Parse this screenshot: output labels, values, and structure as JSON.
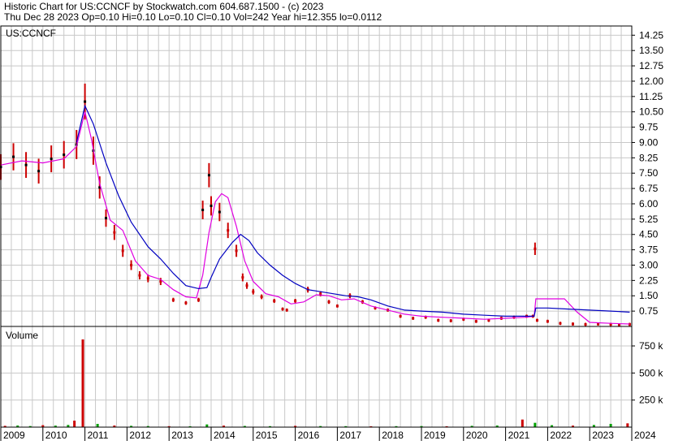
{
  "header": {
    "line1": "Historic Chart for US:CCNCF by Stockwatch.com 604.687.1500 - (c) 2023",
    "line2": "Thu Dec 28 2023  Op=0.10  Hi=0.10  Lo=0.10  Cl=0.10  Vol=242  Year hi=12.355  lo=0.0112"
  },
  "colors": {
    "background": "#ffffff",
    "grid": "#c8c8c8",
    "frame": "#000000",
    "price_bars": "#cc0000",
    "price_bars_dark": "#000000",
    "ma_short": "#e000e0",
    "ma_long": "#0000c0",
    "volume_up": "#00a000",
    "volume_down": "#cc0000"
  },
  "chart_data": [
    {
      "type": "line",
      "title": "US:CCNCF",
      "xlabel": "",
      "ylabel": "",
      "ylim": [
        0,
        14.7
      ],
      "xlim": [
        2009.0,
        2024.0
      ],
      "y_ticks": [
        "0.75",
        "1.50",
        "2.25",
        "3.00",
        "3.75",
        "4.50",
        "5.25",
        "6.00",
        "6.75",
        "7.50",
        "8.25",
        "9.00",
        "9.75",
        "10.50",
        "11.25",
        "12.00",
        "12.75",
        "13.50",
        "14.25"
      ],
      "y_tick_values": [
        0.75,
        1.5,
        2.25,
        3.0,
        3.75,
        4.5,
        5.25,
        6.0,
        6.75,
        7.5,
        8.25,
        9.0,
        9.75,
        10.5,
        11.25,
        12.0,
        12.75,
        13.5,
        14.25
      ],
      "grid": true,
      "series": [
        {
          "role": "price",
          "x": [
            2009.0,
            2009.3,
            2009.6,
            2009.9,
            2010.2,
            2010.5,
            2010.8,
            2011.0,
            2011.2,
            2011.35,
            2011.5,
            2011.7,
            2011.9,
            2012.1,
            2012.3,
            2012.5,
            2012.8,
            2013.1,
            2013.4,
            2013.7,
            2013.8,
            2013.95,
            2014.0,
            2014.2,
            2014.4,
            2014.6,
            2014.75,
            2014.85,
            2015.0,
            2015.2,
            2015.5,
            2015.7,
            2015.8,
            2016.0,
            2016.3,
            2016.6,
            2016.8,
            2017.0,
            2017.3,
            2017.6,
            2017.9,
            2018.2,
            2018.5,
            2018.8,
            2019.1,
            2019.4,
            2019.7,
            2020.0,
            2020.3,
            2020.6,
            2020.9,
            2021.2,
            2021.5,
            2021.65,
            2021.7,
            2021.75,
            2022.0,
            2022.3,
            2022.6,
            2022.9,
            2023.2,
            2023.5,
            2023.7,
            2023.95
          ],
          "values": [
            7.8,
            8.3,
            7.9,
            7.6,
            8.2,
            8.4,
            8.9,
            11.0,
            8.6,
            6.8,
            5.3,
            4.6,
            3.7,
            3.0,
            2.5,
            2.35,
            2.2,
            1.3,
            1.15,
            1.3,
            5.7,
            7.4,
            5.9,
            5.6,
            4.7,
            3.7,
            2.4,
            2.0,
            1.7,
            1.45,
            1.25,
            0.85,
            0.8,
            1.25,
            1.8,
            1.6,
            1.2,
            1.0,
            1.5,
            1.2,
            0.9,
            0.8,
            0.5,
            0.4,
            0.45,
            0.3,
            0.28,
            0.35,
            0.25,
            0.3,
            0.4,
            0.45,
            0.5,
            0.5,
            3.8,
            0.3,
            0.25,
            0.15,
            0.12,
            0.1,
            0.12,
            0.1,
            0.08,
            0.1
          ]
        },
        {
          "role": "moving-average-short",
          "x": [
            2009.0,
            2009.5,
            2010.0,
            2010.5,
            2010.8,
            2011.0,
            2011.15,
            2011.35,
            2011.6,
            2011.9,
            2012.2,
            2012.5,
            2012.8,
            2013.1,
            2013.4,
            2013.65,
            2013.8,
            2013.95,
            2014.1,
            2014.25,
            2014.4,
            2014.6,
            2014.8,
            2015.0,
            2015.3,
            2015.6,
            2015.9,
            2016.2,
            2016.5,
            2016.8,
            2017.1,
            2017.4,
            2017.8,
            2018.2,
            2018.6,
            2019.0,
            2019.5,
            2020.0,
            2020.5,
            2021.0,
            2021.5,
            2021.68,
            2021.72,
            2022.0,
            2022.4,
            2022.7,
            2023.0,
            2023.5,
            2023.95
          ],
          "values": [
            7.9,
            8.1,
            8.0,
            8.2,
            8.8,
            10.5,
            9.2,
            7.0,
            5.2,
            4.7,
            3.2,
            2.5,
            2.3,
            1.8,
            1.45,
            1.4,
            2.5,
            4.6,
            6.1,
            6.5,
            6.3,
            4.9,
            3.2,
            2.2,
            1.6,
            1.45,
            1.1,
            1.2,
            1.55,
            1.5,
            1.3,
            1.35,
            1.0,
            0.8,
            0.6,
            0.5,
            0.45,
            0.4,
            0.35,
            0.4,
            0.45,
            0.5,
            1.35,
            1.35,
            1.35,
            0.7,
            0.2,
            0.15,
            0.12
          ]
        },
        {
          "role": "moving-average-long",
          "x": [
            2010.8,
            2011.0,
            2011.2,
            2011.5,
            2011.8,
            2012.1,
            2012.5,
            2012.8,
            2013.1,
            2013.4,
            2013.7,
            2013.9,
            2014.0,
            2014.2,
            2014.5,
            2014.7,
            2014.9,
            2015.1,
            2015.4,
            2015.7,
            2016.0,
            2016.3,
            2016.6,
            2016.9,
            2017.2,
            2017.5,
            2017.8,
            2018.2,
            2018.6,
            2019.0,
            2019.5,
            2020.0,
            2020.5,
            2021.0,
            2021.5,
            2021.68,
            2021.72,
            2022.0,
            2022.5,
            2023.0,
            2023.5,
            2023.95
          ],
          "values": [
            9.0,
            10.8,
            9.9,
            8.0,
            6.4,
            5.1,
            3.9,
            3.3,
            2.6,
            2.0,
            1.85,
            1.9,
            2.4,
            3.3,
            4.1,
            4.5,
            4.2,
            3.6,
            3.0,
            2.5,
            2.1,
            1.8,
            1.7,
            1.6,
            1.5,
            1.45,
            1.3,
            1.0,
            0.8,
            0.75,
            0.7,
            0.6,
            0.55,
            0.5,
            0.5,
            0.5,
            0.9,
            0.9,
            0.85,
            0.8,
            0.75,
            0.7
          ]
        }
      ]
    },
    {
      "type": "bar",
      "title": "Volume",
      "xlabel": "",
      "ylabel": "",
      "ylim": [
        0,
        900000
      ],
      "y_ticks": [
        "250 k",
        "500 k",
        "750 k"
      ],
      "y_tick_values": [
        250000,
        500000,
        750000
      ],
      "x_ticks": [
        "2009",
        "2010",
        "2011",
        "2012",
        "2013",
        "2014",
        "2015",
        "2016",
        "2017",
        "2018",
        "2019",
        "2020",
        "2021",
        "2022",
        "2023",
        "2024"
      ],
      "x_tick_values": [
        2009,
        2010,
        2011,
        2012,
        2013,
        2014,
        2015,
        2016,
        2017,
        2018,
        2019,
        2020,
        2021,
        2022,
        2023,
        2024
      ],
      "grid": true,
      "series": [
        {
          "role": "volume",
          "x": [
            2009.1,
            2009.4,
            2009.7,
            2010.0,
            2010.3,
            2010.6,
            2010.75,
            2010.95,
            2011.3,
            2011.7,
            2012.1,
            2012.5,
            2013.0,
            2013.5,
            2013.9,
            2014.3,
            2014.8,
            2015.4,
            2016.0,
            2016.6,
            2017.2,
            2017.8,
            2018.4,
            2019.0,
            2019.6,
            2020.2,
            2020.8,
            2021.4,
            2021.7,
            2022.1,
            2022.6,
            2023.1,
            2023.5,
            2023.9
          ],
          "values": [
            12000,
            15000,
            10000,
            18000,
            14000,
            20000,
            60000,
            810000,
            30000,
            15000,
            12000,
            10000,
            9000,
            8000,
            25000,
            14000,
            11000,
            9000,
            12000,
            10000,
            9000,
            8000,
            9000,
            10000,
            8000,
            12000,
            15000,
            70000,
            40000,
            18000,
            14000,
            20000,
            30000,
            35000
          ]
        }
      ]
    }
  ]
}
